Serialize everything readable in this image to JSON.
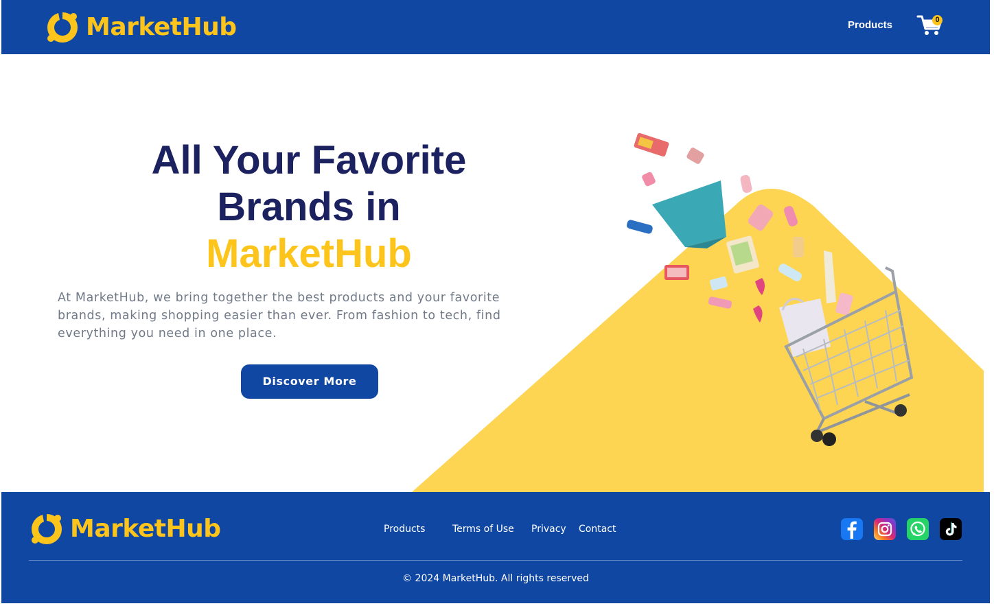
{
  "brand": {
    "name": "MarketHub",
    "primary_color": "#1047a3",
    "accent_color": "#fdc51c",
    "heading_color": "#1c2160"
  },
  "header": {
    "nav_products": "Products",
    "cart_icon": "shopping-cart-icon",
    "cart_count": "0"
  },
  "hero": {
    "title_line1": "All Your Favorite",
    "title_line2": "Brands in",
    "title_accent": "MarketHub",
    "description": "At MarketHub, we bring together the best products and your favorite brands, making shopping easier than ever. From fashion to tech, find everything you need in one place.",
    "cta_label": "Discover More"
  },
  "footer": {
    "links": [
      "Products",
      "Terms of Use",
      "Privacy",
      "Contact"
    ],
    "social_icons": [
      "facebook-icon",
      "instagram-icon",
      "whatsapp-icon",
      "tiktok-icon"
    ],
    "copyright": "© 2024 MarketHub. All rights reserved"
  }
}
